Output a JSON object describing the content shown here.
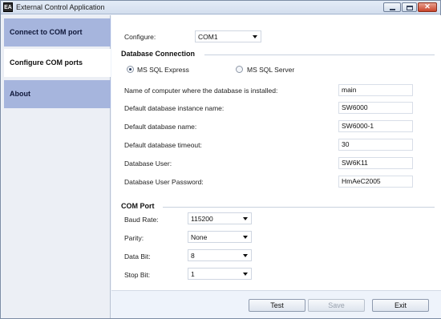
{
  "window": {
    "title": "External Control Application",
    "icon_text": "EA"
  },
  "sidebar": {
    "items": [
      {
        "label": "Connect to COM port"
      },
      {
        "label": "Configure COM ports"
      },
      {
        "label": "About"
      }
    ]
  },
  "configure": {
    "label": "Configure:",
    "value": "COM1"
  },
  "database": {
    "title": "Database Connection",
    "radio_options": [
      {
        "label": "MS SQL Express",
        "selected": true
      },
      {
        "label": "MS SQL Server",
        "selected": false
      }
    ],
    "fields": [
      {
        "label": "Name of computer where the database is installed:",
        "value": "main"
      },
      {
        "label": "Default database instance name:",
        "value": "SW6000"
      },
      {
        "label": "Default database name:",
        "value": "SW6000-1"
      },
      {
        "label": "Default database timeout:",
        "value": "30"
      },
      {
        "label": "Database User:",
        "value": "SW6K11"
      },
      {
        "label": "Database User Password:",
        "value": "HmAeC2005"
      }
    ]
  },
  "com_port": {
    "title": "COM Port",
    "fields": [
      {
        "label": "Baud Rate:",
        "value": "115200"
      },
      {
        "label": "Parity:",
        "value": "None"
      },
      {
        "label": "Data Bit:",
        "value": "8"
      },
      {
        "label": "Stop Bit:",
        "value": "1"
      }
    ]
  },
  "buttons": {
    "test": "Test",
    "save": "Save",
    "exit": "Exit"
  }
}
